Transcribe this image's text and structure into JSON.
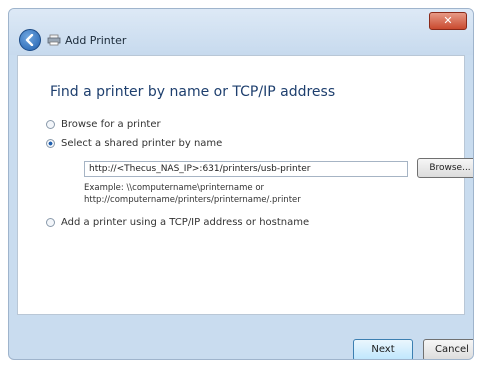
{
  "window": {
    "title": "Add Printer",
    "close_label": "✕"
  },
  "page": {
    "heading": "Find a printer by name or TCP/IP address",
    "options": [
      {
        "label": "Browse for a printer",
        "selected": false
      },
      {
        "label": "Select a shared printer by name",
        "selected": true
      },
      {
        "label": "Add a printer using a TCP/IP address or hostname",
        "selected": false
      }
    ],
    "url_value": "http://<Thecus_NAS_IP>:631/printers/usb-printer",
    "browse_label": "Browse...",
    "example_line1": "Example: \\\\computername\\printername or",
    "example_line2": "http://computername/printers/printername/.printer"
  },
  "footer": {
    "next_label": "Next",
    "cancel_label": "Cancel"
  }
}
